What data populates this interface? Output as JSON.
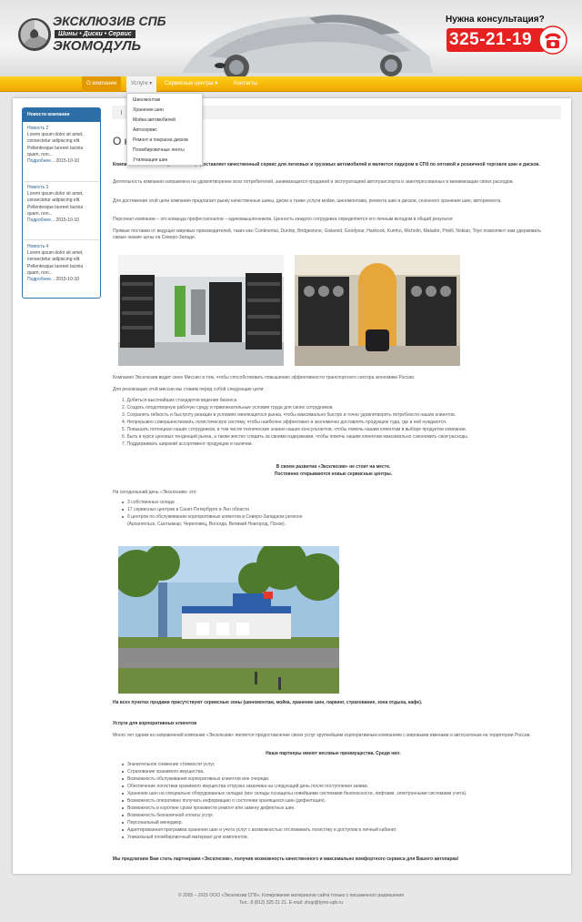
{
  "header": {
    "logo_line1": "ЭКСКЛЮЗИВ СПБ",
    "logo_line2": "Шины • Диски • Сервис",
    "logo_line3": "ЭКОМОДУЛЬ",
    "consult_label": "Нужна консультация?",
    "phone": "325-21-19"
  },
  "nav": {
    "items": [
      {
        "label": "О компании"
      },
      {
        "label": "Услуги ▾"
      },
      {
        "label": "Сервисные центры ▾"
      },
      {
        "label": "Контакты"
      }
    ]
  },
  "dropdown": {
    "items": [
      "Шиномонтаж",
      "Хранение шин",
      "Мойка автомобилей",
      "Автосервис",
      "Ремонт и покраска дисков",
      "Пломбировочные ленты",
      "Утилизация шин"
    ]
  },
  "sidebar": {
    "title": "Новости компании",
    "news": [
      {
        "title": "Новость 2",
        "body": "Lorem ipsum dolor sit amet, consectetur adipiscing elit. Pellentesque laoreet lacinia quam, non...",
        "more": "Подробнее...",
        "date": "2015-10-10"
      },
      {
        "title": "Новость 3",
        "body": "Lorem ipsum dolor sit amet, consectetur adipiscing elit. Pellentesque laoreet lacinia quam, non...",
        "more": "Подробнее...",
        "date": "2015-10-10"
      },
      {
        "title": "Новость 4",
        "body": "Lorem ipsum dolor sit amet, consectetur adipiscing elit. Pellentesque laoreet lacinia quam, non...",
        "more": "Подробнее...",
        "date": "2015-10-10"
      }
    ]
  },
  "content": {
    "title": "О компании",
    "intro": "Компания «Эксклюзив» уже 20 лет предоставляет качественный сервис для легковых и грузовых автомобилей и является лидером в СПб по оптовой и розничной торговле шин и дисков.",
    "p1": "Деятельность компании направлена на удовлетворение всех потребителей, занимающихся продажей и эксплуатацией автотранспорта и заинтересованных в минимизации своих расходов.",
    "p2": "Для достижения этой цели компания предлагает рынку качественные шины, диски а также услуги мойки, шиномонтажа, ремонта шин и дисков, сезонного хранения шин, авторемонта.",
    "p3": "Персонал компании – это команда профессионалов – единомышленников. Ценность каждого сотрудника определяется его личным вкладом в общий результат.",
    "p4": "Прямые поставки от ведущих мировых производителей, таких как: Continental, Dunlop, Bridgestone, Gislaved, Goodyear, Hankook, Kumho, Michelin, Matador, Pirelli, Nokian, Toyo позволяют нам удерживать самые низкие цены на Северо-Западе.",
    "p5": "Компания Эксклюзив видит свою Миссию в том, чтобы способствовать повышению эффективности транспортного сектора экономики России.",
    "p6": "Для реализации этой миссии мы ставим перед собой следующие цели:",
    "goals": [
      "1. Добиться высочайших стандартов ведения бизнеса",
      "2. Создать плодотворную рабочую среду и привлекательные условия труда для своих сотрудников.",
      "3. Сохранять гибкость и быстроту реакции в условиях меняющегося рынка, чтобы максимально быстро и точно удовлетворять потребности наших клиентов.",
      "4. Непрерывно совершенствовать логистическую систему, чтобы наиболее эффективно и экономично доставлять продукцию туда, где в ней нуждаются.",
      "5. Повышать потенциал наших сотрудников, в том числе технические знания наших консультантов, чтобы помочь нашим клиентам в выборе продуктов компании.",
      "6. Быть в курсе ценовых тенденций рынка, а также жестко следить за своими издержками, чтобы помочь нашим клиентам максимально сэкономить свои расходы.",
      "7. Поддерживать широкий ассортимент продукции в наличии."
    ],
    "dev1": "В своем развитии «Эксклюзив» не стоит на месте.",
    "dev2": "Постоянно открываются новые сервисные центры.",
    "today": "На сегодняшний день «Эксклюзив» это:",
    "today_items": [
      "3 собственных склада",
      "17 сервисных центров в Санкт-Петербурге и Лен области",
      "6 центров по обслуживанию корпоративных клиентов в Северо-Западном регионе",
      "(Архангельск, Сыктывкар, Череповец, Вологда, Великий Новгород, Псков)."
    ],
    "zones": "На всех пунктах продажи присутствуют сервисные зоны (шиномонтаж, мойка, хранение шин, паркинг, страхование, зона отдыха, кафе).",
    "corp_title": "Услуги для корпоративных клиентов",
    "corp_text": "Много лет одним из направлений компании «Эксклюзив» является предоставление своих услуг крупнейшим корпоративным компаниям с мировыми именами и автосалонам на территории России.",
    "partners": "Наши партнеры имеют весомые преимущества. Среди них:",
    "benefits": [
      "Значительное снижение стоимости услуг.",
      "Страхование хранимого имущества.",
      "Возможность обслуживания корпоративных клиентов вне очереди.",
      "Обеспечение логистики хранимого имущества отгрузка заказчика на следующий день после поступления заявки.",
      "Хранение шин на специально оборудованных складах (все склады оснащены новейшими системами безопасности, лифтами, электронными системами учета).",
      "Возможность оперативно получать информацию о состоянии хранящихся шин (дефектация).",
      "Возможность в короткие сроки произвести ремонт или замену дефектных шин.",
      "Возможность безналичной оплаты услуг.",
      "Персональный менеджер.",
      "Адаптированная программа хранения шин и учета услуг с возможностью отслеживать логистику и доступом в личный кабинет.",
      "Уникальный пломбировочный материал для комплектов."
    ],
    "closing": "Мы предлагаем Вам стать партнерами «Эксклюзив», получив возможность качественного и максимально комфортного сервиса для Вашего автопарка!"
  },
  "footer": {
    "line1": "© 2005 – 2015 ООО «Эксклюзив СПб». Копирование материалов сайта только с письменного разрешения",
    "line2": "Тел.: 8 (812) 325 21 21. E-mail: shop@tyres-spb.ru"
  },
  "colors": {
    "accent": "#f5b400",
    "brand_blue": "#2e6ea6",
    "phone_red": "#e6211f"
  }
}
